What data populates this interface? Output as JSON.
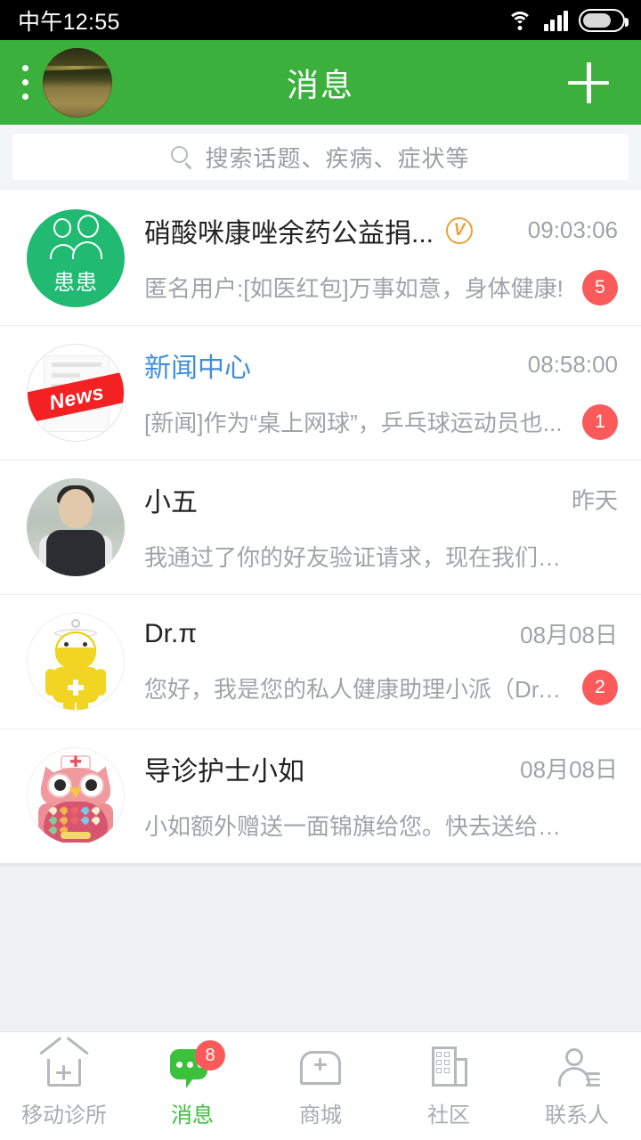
{
  "status_bar": {
    "time": "中午12:55",
    "icons": [
      "wifi-icon",
      "signal-icon",
      "battery-icon"
    ]
  },
  "app_bar": {
    "menu_icon": "overflow-menu-icon",
    "avatar": "user-avatar",
    "title": "消息",
    "add_icon": "plus-icon",
    "background_color": "#3cb03c"
  },
  "search": {
    "icon": "search-icon",
    "placeholder": "搜索话题、疾病、症状等",
    "value": ""
  },
  "conversations": [
    {
      "avatar_type": "patient-group-avatar",
      "avatar_text": "患患",
      "title": "硝酸咪康唑余药公益捐...",
      "verified": true,
      "verified_mark": "V",
      "time": "09:03:06",
      "preview": "匿名用户:[如医红包]万事如意，身体健康!",
      "badge": "5",
      "title_color": "#222222"
    },
    {
      "avatar_type": "news-avatar",
      "avatar_text": "News",
      "title": "新闻中心",
      "verified": false,
      "verified_mark": "",
      "time": "08:58:00",
      "preview": "[新闻]作为“桌上网球”，乒乓球运动员也...",
      "badge": "1",
      "title_color": "#3f8fd6"
    },
    {
      "avatar_type": "photo-avatar",
      "avatar_text": "",
      "title": "小五",
      "verified": false,
      "verified_mark": "",
      "time": "昨天",
      "preview": "我通过了你的好友验证请求，现在我们可以...",
      "badge": "",
      "title_color": "#222222"
    },
    {
      "avatar_type": "robot-doctor-avatar",
      "avatar_text": "",
      "title": "Dr.π",
      "verified": false,
      "verified_mark": "",
      "time": "08月08日",
      "preview": "您好，我是您的私人健康助理小派（Dr.π...",
      "badge": "2",
      "title_color": "#222222"
    },
    {
      "avatar_type": "owl-nurse-avatar",
      "avatar_text": "",
      "title": "导诊护士小如",
      "verified": false,
      "verified_mark": "",
      "time": "08月08日",
      "preview": "小如额外赠送一面锦旗给您。快去送给您喜...",
      "badge": "",
      "title_color": "#222222"
    }
  ],
  "tab_bar": {
    "active_color": "#3cc13c",
    "inactive_color": "#a8acb0",
    "items": [
      {
        "label": "移动诊所",
        "icon": "clinic-house-icon",
        "badge": "",
        "active": false
      },
      {
        "label": "消息",
        "icon": "chat-bubble-icon",
        "badge": "8",
        "active": true
      },
      {
        "label": "商城",
        "icon": "shop-icon",
        "badge": "",
        "active": false
      },
      {
        "label": "社区",
        "icon": "building-icon",
        "badge": "",
        "active": false
      },
      {
        "label": "联系人",
        "icon": "contact-person-icon",
        "badge": "",
        "active": false
      }
    ]
  },
  "colors": {
    "header_green": "#3cb03c",
    "badge_red": "#fb5a5a",
    "page_background": "#eff2f5",
    "patient_avatar_green": "#21ba72"
  }
}
